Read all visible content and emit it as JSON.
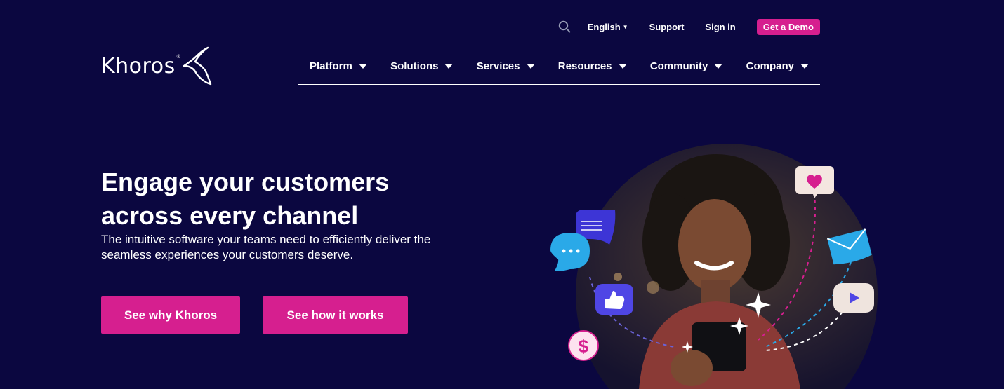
{
  "utility": {
    "language": "English",
    "support": "Support",
    "sign_in": "Sign in",
    "demo": "Get a Demo"
  },
  "logo": {
    "text": "Khoros",
    "reg_mark": "®"
  },
  "nav": {
    "items": [
      {
        "label": "Platform"
      },
      {
        "label": "Solutions"
      },
      {
        "label": "Services"
      },
      {
        "label": "Resources"
      },
      {
        "label": "Community"
      },
      {
        "label": "Company"
      }
    ]
  },
  "hero": {
    "title_line1": "Engage your customers",
    "title_line2": "across every channel",
    "subtitle_line1": "The intuitive software your teams need to efficiently deliver the",
    "subtitle_line2": "seamless experiences your customers deserve.",
    "cta_primary": "See why Khoros",
    "cta_secondary": "See how it works",
    "dollar_symbol": "$"
  },
  "icons": {
    "search": "search-icon",
    "language_caret": "caret-down-icon",
    "nav_caret": "triangle-down-icon",
    "logo_mark": "khoros-k-mark-icon",
    "chat": "chat-bubble-icon",
    "message_lines": "message-lines-icon",
    "thumbs_up": "thumbs-up-icon",
    "dollar": "dollar-coin-icon",
    "heart": "heart-icon",
    "mail": "mail-envelope-icon",
    "play": "play-video-icon"
  },
  "colors": {
    "background": "#0b0740",
    "accent": "#d61f8f",
    "text": "#ffffff",
    "chat_blue": "#2aa9e8",
    "purple_bubble": "#3d35d6"
  }
}
